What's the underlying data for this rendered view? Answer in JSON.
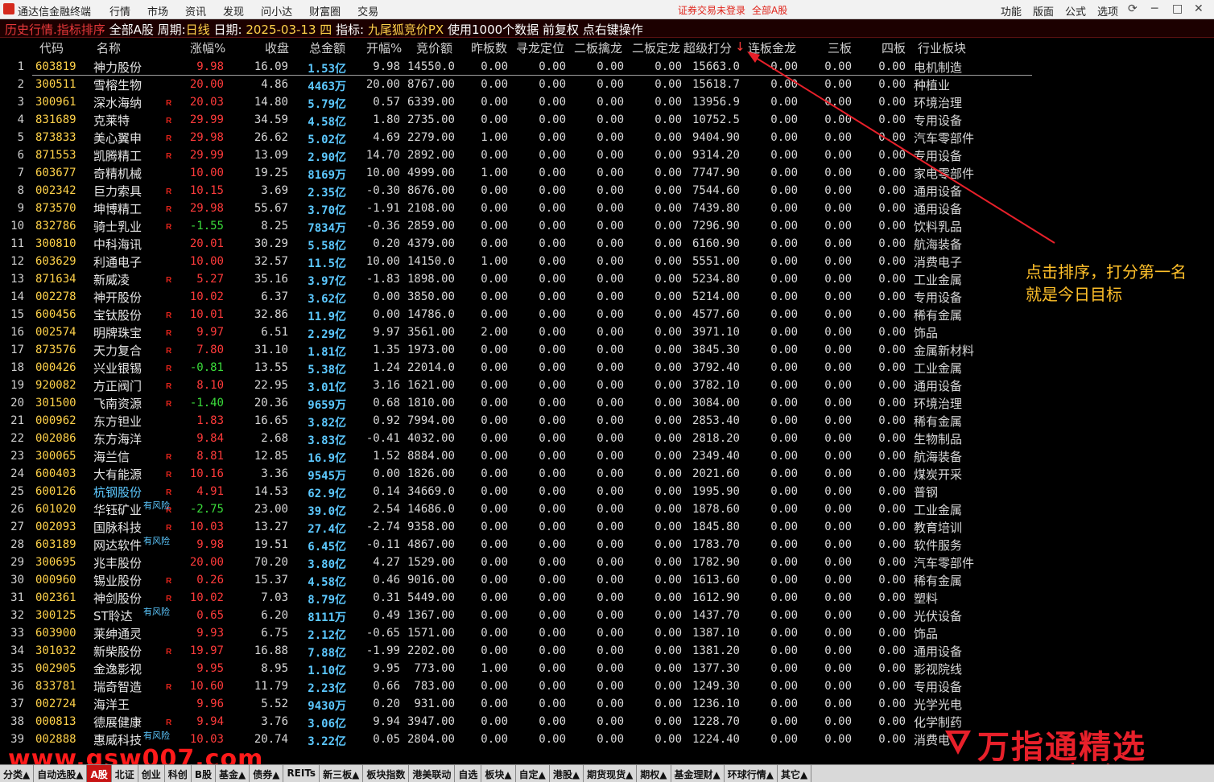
{
  "app": {
    "name": "通达信金融终端",
    "menu": [
      "行情",
      "市场",
      "资讯",
      "发现",
      "问小达",
      "财富圈",
      "交易"
    ],
    "status": "证券交易未登录",
    "status_market": "全部A股",
    "right_menu": [
      "功能",
      "版面",
      "公式",
      "选项"
    ],
    "window_controls": [
      "⟳",
      "─",
      "□",
      "✕"
    ]
  },
  "infobar": {
    "mode": "历史行情.指标排序",
    "market": "全部A股",
    "period_label": "周期:",
    "period": "日线",
    "date_label": "日期:",
    "date": "2025-03-13 四",
    "indicator_label": "指标:",
    "indicator": "九尾狐竞价PX",
    "extra": "使用1000个数据 前复权 点右键操作"
  },
  "columns": {
    "code": "代码",
    "name": "名称",
    "chg": "涨幅%",
    "close": "收盘",
    "amt": "总金额",
    "open": "开幅%",
    "bid": "竞价额",
    "prev": "昨板数",
    "seek": "寻龙定位",
    "qin": "二板擒龙",
    "ding": "二板定龙",
    "score": "超级打分",
    "sort_arrow": "↓",
    "lian": "连板金龙",
    "san": "三板",
    "si": "四板",
    "ind": "行业板块"
  },
  "rows": [
    {
      "i": "1",
      "code": "603819",
      "name": "神力股份",
      "r": false,
      "risk": "",
      "chg": "9.98",
      "close": "16.09",
      "amt": "1.53亿",
      "open": "9.98",
      "bid": "14550.0",
      "prev": "0.00",
      "seek": "0.00",
      "qin": "0.00",
      "ding": "0.00",
      "score": "15663.0",
      "lian": "0.00",
      "san": "0.00",
      "si": "0.00",
      "ind": "电机制造"
    },
    {
      "i": "2",
      "code": "300511",
      "name": "雪榕生物",
      "r": false,
      "risk": "",
      "chg": "20.00",
      "close": "4.86",
      "amt": "4463万",
      "open": "20.00",
      "bid": "8767.00",
      "prev": "0.00",
      "seek": "0.00",
      "qin": "0.00",
      "ding": "0.00",
      "score": "15618.7",
      "lian": "0.00",
      "san": "0.00",
      "si": "0.00",
      "ind": "种植业"
    },
    {
      "i": "3",
      "code": "300961",
      "name": "深水海纳",
      "r": true,
      "risk": "",
      "chg": "20.03",
      "close": "14.80",
      "amt": "5.79亿",
      "open": "0.57",
      "bid": "6339.00",
      "prev": "0.00",
      "seek": "0.00",
      "qin": "0.00",
      "ding": "0.00",
      "score": "13956.9",
      "lian": "0.00",
      "san": "0.00",
      "si": "0.00",
      "ind": "环境治理"
    },
    {
      "i": "4",
      "code": "831689",
      "name": "克莱特",
      "r": true,
      "risk": "",
      "chg": "29.99",
      "close": "34.59",
      "amt": "4.58亿",
      "open": "1.80",
      "bid": "2735.00",
      "prev": "0.00",
      "seek": "0.00",
      "qin": "0.00",
      "ding": "0.00",
      "score": "10752.5",
      "lian": "0.00",
      "san": "0.00",
      "si": "0.00",
      "ind": "专用设备"
    },
    {
      "i": "5",
      "code": "873833",
      "name": "美心翼申",
      "r": true,
      "risk": "",
      "chg": "29.98",
      "close": "26.62",
      "amt": "5.02亿",
      "open": "4.69",
      "bid": "2279.00",
      "prev": "1.00",
      "seek": "0.00",
      "qin": "0.00",
      "ding": "0.00",
      "score": "9404.90",
      "lian": "0.00",
      "san": "0.00",
      "si": "0.00",
      "ind": "汽车零部件"
    },
    {
      "i": "6",
      "code": "871553",
      "name": "凯腾精工",
      "r": true,
      "risk": "",
      "chg": "29.99",
      "close": "13.09",
      "amt": "2.90亿",
      "open": "14.70",
      "bid": "2892.00",
      "prev": "0.00",
      "seek": "0.00",
      "qin": "0.00",
      "ding": "0.00",
      "score": "9314.20",
      "lian": "0.00",
      "san": "0.00",
      "si": "0.00",
      "ind": "专用设备"
    },
    {
      "i": "7",
      "code": "603677",
      "name": "奇精机械",
      "r": false,
      "risk": "",
      "chg": "10.00",
      "close": "19.25",
      "amt": "8169万",
      "open": "10.00",
      "bid": "4999.00",
      "prev": "1.00",
      "seek": "0.00",
      "qin": "0.00",
      "ding": "0.00",
      "score": "7747.90",
      "lian": "0.00",
      "san": "0.00",
      "si": "0.00",
      "ind": "家电零部件"
    },
    {
      "i": "8",
      "code": "002342",
      "name": "巨力索具",
      "r": true,
      "risk": "",
      "chg": "10.15",
      "close": "3.69",
      "amt": "2.35亿",
      "open": "-0.30",
      "bid": "8676.00",
      "prev": "0.00",
      "seek": "0.00",
      "qin": "0.00",
      "ding": "0.00",
      "score": "7544.60",
      "lian": "0.00",
      "san": "0.00",
      "si": "0.00",
      "ind": "通用设备"
    },
    {
      "i": "9",
      "code": "873570",
      "name": "坤博精工",
      "r": true,
      "risk": "",
      "chg": "29.98",
      "close": "55.67",
      "amt": "3.70亿",
      "open": "-1.91",
      "bid": "2108.00",
      "prev": "0.00",
      "seek": "0.00",
      "qin": "0.00",
      "ding": "0.00",
      "score": "7439.80",
      "lian": "0.00",
      "san": "0.00",
      "si": "0.00",
      "ind": "通用设备"
    },
    {
      "i": "10",
      "code": "832786",
      "name": "骑士乳业",
      "r": true,
      "risk": "",
      "chg": "-1.55",
      "close": "8.25",
      "amt": "7834万",
      "open": "-0.36",
      "bid": "2859.00",
      "prev": "0.00",
      "seek": "0.00",
      "qin": "0.00",
      "ding": "0.00",
      "score": "7296.90",
      "lian": "0.00",
      "san": "0.00",
      "si": "0.00",
      "ind": "饮料乳品"
    },
    {
      "i": "11",
      "code": "300810",
      "name": "中科海讯",
      "r": false,
      "risk": "",
      "chg": "20.01",
      "close": "30.29",
      "amt": "5.58亿",
      "open": "0.20",
      "bid": "4379.00",
      "prev": "0.00",
      "seek": "0.00",
      "qin": "0.00",
      "ding": "0.00",
      "score": "6160.90",
      "lian": "0.00",
      "san": "0.00",
      "si": "0.00",
      "ind": "航海装备"
    },
    {
      "i": "12",
      "code": "603629",
      "name": "利通电子",
      "r": false,
      "risk": "",
      "chg": "10.00",
      "close": "32.57",
      "amt": "11.5亿",
      "open": "10.00",
      "bid": "14150.0",
      "prev": "1.00",
      "seek": "0.00",
      "qin": "0.00",
      "ding": "0.00",
      "score": "5551.00",
      "lian": "0.00",
      "san": "0.00",
      "si": "0.00",
      "ind": "消费电子"
    },
    {
      "i": "13",
      "code": "871634",
      "name": "新威凌",
      "r": true,
      "risk": "",
      "chg": "5.27",
      "close": "35.16",
      "amt": "3.97亿",
      "open": "-1.83",
      "bid": "1898.00",
      "prev": "0.00",
      "seek": "0.00",
      "qin": "0.00",
      "ding": "0.00",
      "score": "5234.80",
      "lian": "0.00",
      "san": "0.00",
      "si": "0.00",
      "ind": "工业金属"
    },
    {
      "i": "14",
      "code": "002278",
      "name": "神开股份",
      "r": false,
      "risk": "",
      "chg": "10.02",
      "close": "6.37",
      "amt": "3.62亿",
      "open": "0.00",
      "bid": "3850.00",
      "prev": "0.00",
      "seek": "0.00",
      "qin": "0.00",
      "ding": "0.00",
      "score": "5214.00",
      "lian": "0.00",
      "san": "0.00",
      "si": "0.00",
      "ind": "专用设备"
    },
    {
      "i": "15",
      "code": "600456",
      "name": "宝钛股份",
      "r": true,
      "risk": "",
      "chg": "10.01",
      "close": "32.86",
      "amt": "11.9亿",
      "open": "0.00",
      "bid": "14786.0",
      "prev": "0.00",
      "seek": "0.00",
      "qin": "0.00",
      "ding": "0.00",
      "score": "4577.60",
      "lian": "0.00",
      "san": "0.00",
      "si": "0.00",
      "ind": "稀有金属"
    },
    {
      "i": "16",
      "code": "002574",
      "name": "明牌珠宝",
      "r": true,
      "risk": "",
      "chg": "9.97",
      "close": "6.51",
      "amt": "2.29亿",
      "open": "9.97",
      "bid": "3561.00",
      "prev": "2.00",
      "seek": "0.00",
      "qin": "0.00",
      "ding": "0.00",
      "score": "3971.10",
      "lian": "0.00",
      "san": "0.00",
      "si": "0.00",
      "ind": "饰品"
    },
    {
      "i": "17",
      "code": "873576",
      "name": "天力复合",
      "r": true,
      "risk": "",
      "chg": "7.80",
      "close": "31.10",
      "amt": "1.81亿",
      "open": "1.35",
      "bid": "1973.00",
      "prev": "0.00",
      "seek": "0.00",
      "qin": "0.00",
      "ding": "0.00",
      "score": "3845.30",
      "lian": "0.00",
      "san": "0.00",
      "si": "0.00",
      "ind": "金属新材料"
    },
    {
      "i": "18",
      "code": "000426",
      "name": "兴业银锡",
      "r": true,
      "risk": "",
      "chg": "-0.81",
      "close": "13.55",
      "amt": "5.38亿",
      "open": "1.24",
      "bid": "22014.0",
      "prev": "0.00",
      "seek": "0.00",
      "qin": "0.00",
      "ding": "0.00",
      "score": "3792.40",
      "lian": "0.00",
      "san": "0.00",
      "si": "0.00",
      "ind": "工业金属"
    },
    {
      "i": "19",
      "code": "920082",
      "name": "方正阀门",
      "r": true,
      "risk": "",
      "chg": "8.10",
      "close": "22.95",
      "amt": "3.01亿",
      "open": "3.16",
      "bid": "1621.00",
      "prev": "0.00",
      "seek": "0.00",
      "qin": "0.00",
      "ding": "0.00",
      "score": "3782.10",
      "lian": "0.00",
      "san": "0.00",
      "si": "0.00",
      "ind": "通用设备"
    },
    {
      "i": "20",
      "code": "301500",
      "name": "飞南资源",
      "r": true,
      "risk": "",
      "chg": "-1.40",
      "close": "20.36",
      "amt": "9659万",
      "open": "0.68",
      "bid": "1810.00",
      "prev": "0.00",
      "seek": "0.00",
      "qin": "0.00",
      "ding": "0.00",
      "score": "3084.00",
      "lian": "0.00",
      "san": "0.00",
      "si": "0.00",
      "ind": "环境治理"
    },
    {
      "i": "21",
      "code": "000962",
      "name": "东方钽业",
      "r": false,
      "risk": "",
      "chg": "1.83",
      "close": "16.65",
      "amt": "3.82亿",
      "open": "0.92",
      "bid": "7994.00",
      "prev": "0.00",
      "seek": "0.00",
      "qin": "0.00",
      "ding": "0.00",
      "score": "2853.40",
      "lian": "0.00",
      "san": "0.00",
      "si": "0.00",
      "ind": "稀有金属"
    },
    {
      "i": "22",
      "code": "002086",
      "name": "东方海洋",
      "r": false,
      "risk": "",
      "chg": "9.84",
      "close": "2.68",
      "amt": "3.83亿",
      "open": "-0.41",
      "bid": "4032.00",
      "prev": "0.00",
      "seek": "0.00",
      "qin": "0.00",
      "ding": "0.00",
      "score": "2818.20",
      "lian": "0.00",
      "san": "0.00",
      "si": "0.00",
      "ind": "生物制品"
    },
    {
      "i": "23",
      "code": "300065",
      "name": "海兰信",
      "r": true,
      "risk": "",
      "chg": "8.81",
      "close": "12.85",
      "amt": "16.9亿",
      "open": "1.52",
      "bid": "8884.00",
      "prev": "0.00",
      "seek": "0.00",
      "qin": "0.00",
      "ding": "0.00",
      "score": "2349.40",
      "lian": "0.00",
      "san": "0.00",
      "si": "0.00",
      "ind": "航海装备"
    },
    {
      "i": "24",
      "code": "600403",
      "name": "大有能源",
      "r": true,
      "risk": "",
      "chg": "10.16",
      "close": "3.36",
      "amt": "9545万",
      "open": "0.00",
      "bid": "1826.00",
      "prev": "0.00",
      "seek": "0.00",
      "qin": "0.00",
      "ding": "0.00",
      "score": "2021.60",
      "lian": "0.00",
      "san": "0.00",
      "si": "0.00",
      "ind": "煤炭开采"
    },
    {
      "i": "25",
      "code": "600126",
      "name": "杭钢股份",
      "r": true,
      "risk": "",
      "blue": true,
      "chg": "4.91",
      "close": "14.53",
      "amt": "62.9亿",
      "open": "0.14",
      "bid": "34669.0",
      "prev": "0.00",
      "seek": "0.00",
      "qin": "0.00",
      "ding": "0.00",
      "score": "1995.90",
      "lian": "0.00",
      "san": "0.00",
      "si": "0.00",
      "ind": "普钢"
    },
    {
      "i": "26",
      "code": "601020",
      "name": "华钰矿业",
      "r": true,
      "risk": "有风险",
      "chg": "-2.75",
      "close": "23.00",
      "amt": "39.0亿",
      "open": "2.54",
      "bid": "14686.0",
      "prev": "0.00",
      "seek": "0.00",
      "qin": "0.00",
      "ding": "0.00",
      "score": "1878.60",
      "lian": "0.00",
      "san": "0.00",
      "si": "0.00",
      "ind": "工业金属"
    },
    {
      "i": "27",
      "code": "002093",
      "name": "国脉科技",
      "r": true,
      "risk": "",
      "chg": "10.03",
      "close": "13.27",
      "amt": "27.4亿",
      "open": "-2.74",
      "bid": "9358.00",
      "prev": "0.00",
      "seek": "0.00",
      "qin": "0.00",
      "ding": "0.00",
      "score": "1845.80",
      "lian": "0.00",
      "san": "0.00",
      "si": "0.00",
      "ind": "教育培训"
    },
    {
      "i": "28",
      "code": "603189",
      "name": "网达软件",
      "r": false,
      "risk": "有风险",
      "chg": "9.98",
      "close": "19.51",
      "amt": "6.45亿",
      "open": "-0.11",
      "bid": "4867.00",
      "prev": "0.00",
      "seek": "0.00",
      "qin": "0.00",
      "ding": "0.00",
      "score": "1783.70",
      "lian": "0.00",
      "san": "0.00",
      "si": "0.00",
      "ind": "软件服务"
    },
    {
      "i": "29",
      "code": "300695",
      "name": "兆丰股份",
      "r": false,
      "risk": "",
      "chg": "20.00",
      "close": "70.20",
      "amt": "3.80亿",
      "open": "4.27",
      "bid": "1529.00",
      "prev": "0.00",
      "seek": "0.00",
      "qin": "0.00",
      "ding": "0.00",
      "score": "1782.90",
      "lian": "0.00",
      "san": "0.00",
      "si": "0.00",
      "ind": "汽车零部件"
    },
    {
      "i": "30",
      "code": "000960",
      "name": "锡业股份",
      "r": true,
      "risk": "",
      "chg": "0.26",
      "close": "15.37",
      "amt": "4.58亿",
      "open": "0.46",
      "bid": "9016.00",
      "prev": "0.00",
      "seek": "0.00",
      "qin": "0.00",
      "ding": "0.00",
      "score": "1613.60",
      "lian": "0.00",
      "san": "0.00",
      "si": "0.00",
      "ind": "稀有金属"
    },
    {
      "i": "31",
      "code": "002361",
      "name": "神剑股份",
      "r": true,
      "risk": "",
      "chg": "10.02",
      "close": "7.03",
      "amt": "8.79亿",
      "open": "0.31",
      "bid": "5449.00",
      "prev": "0.00",
      "seek": "0.00",
      "qin": "0.00",
      "ding": "0.00",
      "score": "1612.90",
      "lian": "0.00",
      "san": "0.00",
      "si": "0.00",
      "ind": "塑料"
    },
    {
      "i": "32",
      "code": "300125",
      "name": "ST聆达",
      "r": false,
      "risk": "有风险",
      "chg": "0.65",
      "close": "6.20",
      "amt": "8111万",
      "open": "0.49",
      "bid": "1367.00",
      "prev": "0.00",
      "seek": "0.00",
      "qin": "0.00",
      "ding": "0.00",
      "score": "1437.70",
      "lian": "0.00",
      "san": "0.00",
      "si": "0.00",
      "ind": "光伏设备"
    },
    {
      "i": "33",
      "code": "603900",
      "name": "莱绅通灵",
      "r": false,
      "risk": "",
      "chg": "9.93",
      "close": "6.75",
      "amt": "2.12亿",
      "open": "-0.65",
      "bid": "1571.00",
      "prev": "0.00",
      "seek": "0.00",
      "qin": "0.00",
      "ding": "0.00",
      "score": "1387.10",
      "lian": "0.00",
      "san": "0.00",
      "si": "0.00",
      "ind": "饰品"
    },
    {
      "i": "34",
      "code": "301032",
      "name": "新柴股份",
      "r": true,
      "risk": "",
      "chg": "19.97",
      "close": "16.88",
      "amt": "7.88亿",
      "open": "-1.99",
      "bid": "2202.00",
      "prev": "0.00",
      "seek": "0.00",
      "qin": "0.00",
      "ding": "0.00",
      "score": "1381.20",
      "lian": "0.00",
      "san": "0.00",
      "si": "0.00",
      "ind": "通用设备"
    },
    {
      "i": "35",
      "code": "002905",
      "name": "金逸影视",
      "r": false,
      "risk": "",
      "chg": "9.95",
      "close": "8.95",
      "amt": "1.10亿",
      "open": "9.95",
      "bid": "773.00",
      "prev": "1.00",
      "seek": "0.00",
      "qin": "0.00",
      "ding": "0.00",
      "score": "1377.30",
      "lian": "0.00",
      "san": "0.00",
      "si": "0.00",
      "ind": "影视院线"
    },
    {
      "i": "36",
      "code": "833781",
      "name": "瑞奇智造",
      "r": true,
      "risk": "",
      "chg": "10.60",
      "close": "11.79",
      "amt": "2.23亿",
      "open": "0.66",
      "bid": "783.00",
      "prev": "0.00",
      "seek": "0.00",
      "qin": "0.00",
      "ding": "0.00",
      "score": "1249.30",
      "lian": "0.00",
      "san": "0.00",
      "si": "0.00",
      "ind": "专用设备"
    },
    {
      "i": "37",
      "code": "002724",
      "name": "海洋王",
      "r": false,
      "risk": "",
      "chg": "9.96",
      "close": "5.52",
      "amt": "9430万",
      "open": "0.20",
      "bid": "931.00",
      "prev": "0.00",
      "seek": "0.00",
      "qin": "0.00",
      "ding": "0.00",
      "score": "1236.10",
      "lian": "0.00",
      "san": "0.00",
      "si": "0.00",
      "ind": "光学光电"
    },
    {
      "i": "38",
      "code": "000813",
      "name": "德展健康",
      "r": true,
      "risk": "",
      "chg": "9.94",
      "close": "3.76",
      "amt": "3.06亿",
      "open": "9.94",
      "bid": "3947.00",
      "prev": "0.00",
      "seek": "0.00",
      "qin": "0.00",
      "ding": "0.00",
      "score": "1228.70",
      "lian": "0.00",
      "san": "0.00",
      "si": "0.00",
      "ind": "化学制药"
    },
    {
      "i": "39",
      "code": "002888",
      "name": "惠威科技",
      "r": false,
      "risk": "有风险",
      "chg": "10.03",
      "close": "20.74",
      "amt": "3.22亿",
      "open": "0.05",
      "bid": "2804.00",
      "prev": "0.00",
      "seek": "0.00",
      "qin": "0.00",
      "ding": "0.00",
      "score": "1224.40",
      "lian": "0.00",
      "san": "0.00",
      "si": "0.00",
      "ind": "消费电子"
    }
  ],
  "annotation": {
    "line1": "点击排序，打分第一名",
    "line2": "就是今日目标"
  },
  "watermarks": {
    "left": "www.gsw007.com",
    "right_big": "万指通精选",
    "right_small": "www.vipwzt.com"
  },
  "tabs": [
    "分类▲",
    "自动选股▲",
    "A股",
    "北证",
    "创业",
    "科创",
    "B股",
    "基金▲",
    "债券▲",
    "REITs",
    "新三板▲",
    "板块指数",
    "港美联动",
    "自选",
    "板块▲",
    "自定▲",
    "港股▲",
    "期货现货▲",
    "期权▲",
    "基金理财▲",
    "环球行情▲",
    "其它▲"
  ],
  "active_tab": "A股",
  "colors": {
    "up": "#ff3b3b",
    "down": "#3bdc3b",
    "code": "#ffd24a",
    "amount": "#5cc8ff",
    "annotation": "#ffc02a",
    "arrow": "#e8202a"
  }
}
